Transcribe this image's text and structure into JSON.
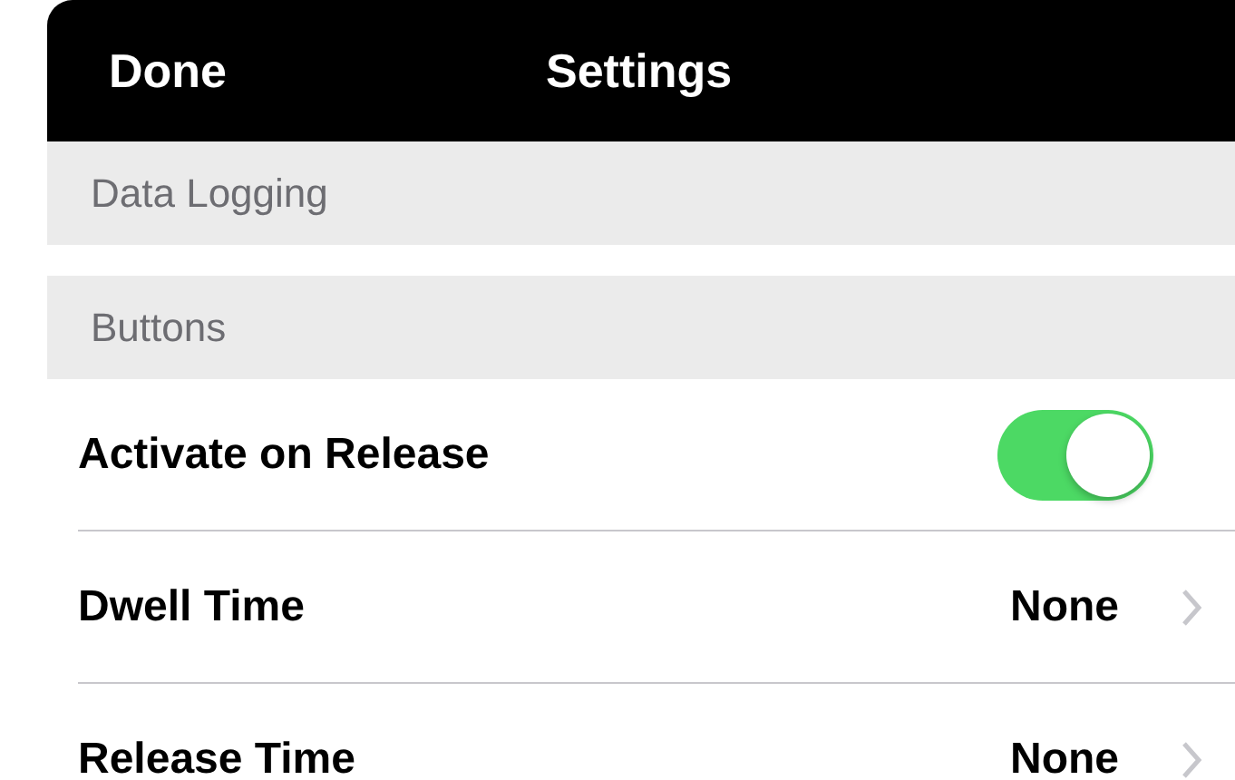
{
  "nav": {
    "left_button": "Done",
    "title": "Settings"
  },
  "sections": [
    {
      "header": "Data Logging"
    },
    {
      "header": "Buttons",
      "rows": [
        {
          "kind": "toggle",
          "label": "Activate on Release",
          "on": true
        },
        {
          "kind": "disclosure",
          "label": "Dwell Time",
          "value": "None"
        },
        {
          "kind": "disclosure",
          "label": "Release Time",
          "value": "None"
        }
      ]
    }
  ]
}
